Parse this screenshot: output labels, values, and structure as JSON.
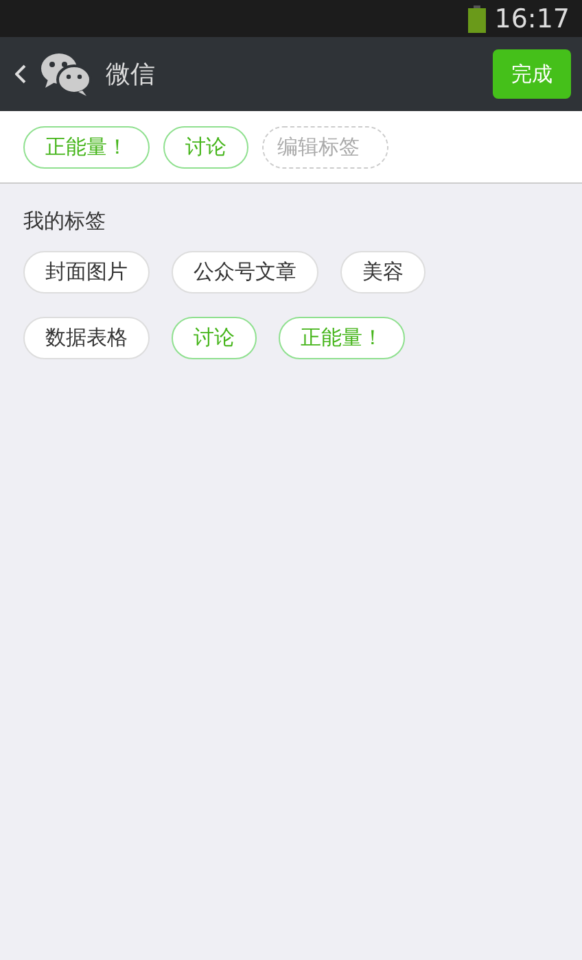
{
  "status_bar": {
    "time": "16:17"
  },
  "header": {
    "title": "微信",
    "done_button": "完成"
  },
  "selected_tags": [
    {
      "label": "正能量！"
    },
    {
      "label": "讨论"
    }
  ],
  "tag_input": {
    "placeholder": "编辑标签"
  },
  "my_tags": {
    "heading": "我的标签",
    "tags": [
      {
        "label": "封面图片",
        "selected": false
      },
      {
        "label": "公众号文章",
        "selected": false
      },
      {
        "label": "美容",
        "selected": false
      },
      {
        "label": "数据表格",
        "selected": false
      },
      {
        "label": "讨论",
        "selected": true
      },
      {
        "label": "正能量！",
        "selected": true
      }
    ]
  }
}
